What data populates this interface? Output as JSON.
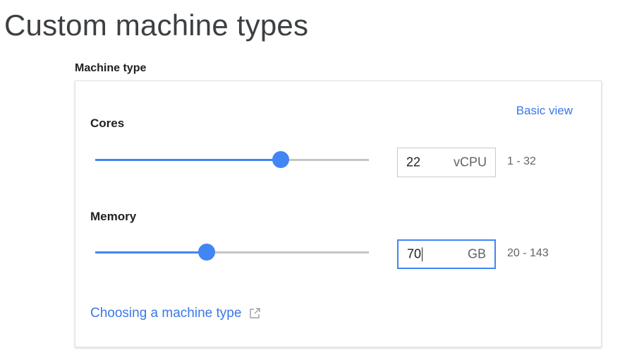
{
  "page": {
    "title": "Custom machine types"
  },
  "machine_type": {
    "label": "Machine type",
    "basic_view_label": "Basic view",
    "cores": {
      "label": "Cores",
      "value": "22",
      "unit": "vCPU",
      "range": "1 - 32",
      "min": 1,
      "max": 32,
      "slider_value": 22
    },
    "memory": {
      "label": "Memory",
      "value": "70",
      "unit": "GB",
      "range": "20 - 143",
      "min": 20,
      "max": 143,
      "slider_value": 70
    },
    "help_link": {
      "label": "Choosing a machine type",
      "icon": "external-link-icon"
    }
  },
  "colors": {
    "accent": "#4285f4",
    "link": "#3b78e7",
    "track": "#c4c4c4"
  }
}
